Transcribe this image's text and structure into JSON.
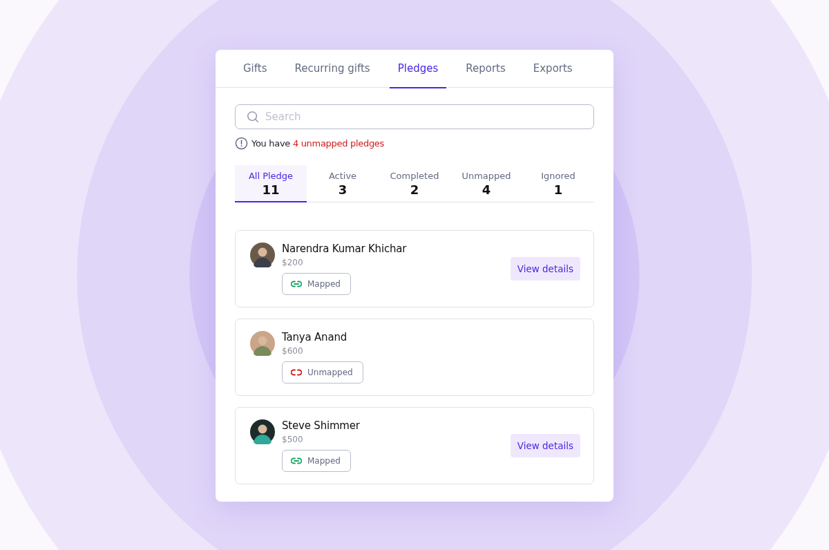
{
  "tabs": [
    {
      "label": "Gifts",
      "selected": false
    },
    {
      "label": "Recurring gifts",
      "selected": false
    },
    {
      "label": "Pledges",
      "selected": true
    },
    {
      "label": "Reports",
      "selected": false
    },
    {
      "label": "Exports",
      "selected": false
    }
  ],
  "search": {
    "placeholder": "Search"
  },
  "alert": {
    "text": "You have",
    "highlight": "4 unmapped pledges"
  },
  "filters": [
    {
      "label": "All Pledge",
      "count": "11",
      "selected": true
    },
    {
      "label": "Active",
      "count": "3",
      "selected": false
    },
    {
      "label": "Completed",
      "count": "2",
      "selected": false
    },
    {
      "label": "Unmapped",
      "count": "4",
      "selected": false
    },
    {
      "label": "Ignored",
      "count": "1",
      "selected": false
    }
  ],
  "pledges": [
    {
      "name": "Narendra Kumar Khichar",
      "amount": "$200",
      "mapped": true,
      "status": "Mapped",
      "action": "View details"
    },
    {
      "name": "Tanya Anand",
      "amount": "$600",
      "mapped": false,
      "status": "Unmapped"
    },
    {
      "name": "Steve Shimmer",
      "amount": "$500",
      "mapped": true,
      "status": "Mapped",
      "action": "View details"
    }
  ]
}
